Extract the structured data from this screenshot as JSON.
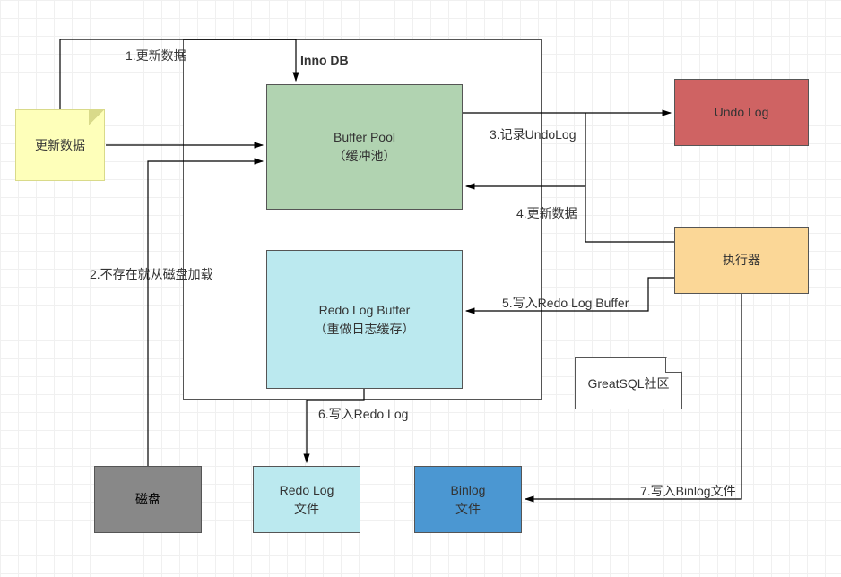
{
  "diagram": {
    "innodb_label": "Inno DB",
    "note_update": "更新数据",
    "buffer_pool_title": "Buffer Pool",
    "buffer_pool_sub": "（缓冲池）",
    "redo_buf_title": "Redo Log Buffer",
    "redo_buf_sub": "（重做日志缓存）",
    "undo_log": "Undo Log",
    "executor": "执行器",
    "greatsql": "GreatSQL社区",
    "disk": "磁盘",
    "redo_file_l1": "Redo Log",
    "redo_file_l2": "文件",
    "binlog_l1": "Binlog",
    "binlog_l2": "文件",
    "edge1": "1.更新数据",
    "edge2": "2.不存在就从磁盘加载",
    "edge3": "3.记录UndoLog",
    "edge4": "4.更新数据",
    "edge5": "5.写入Redo Log Buffer",
    "edge6": "6.写入Redo Log",
    "edge7": "7.写入Binlog文件"
  }
}
